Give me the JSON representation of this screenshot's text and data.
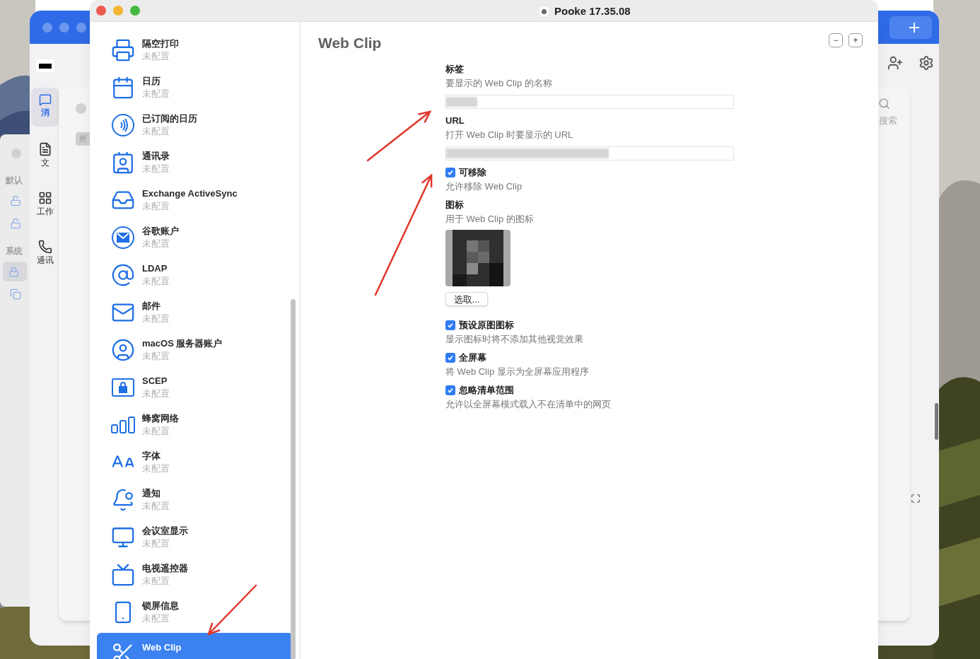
{
  "window": {
    "title": "Pooke 17.35.08"
  },
  "sidebar": {
    "items": [
      {
        "kind": "printer",
        "title": "隔空打印",
        "subtitle": "未配置",
        "selected": false
      },
      {
        "kind": "calendar",
        "title": "日历",
        "subtitle": "未配置",
        "selected": false
      },
      {
        "kind": "subscribed",
        "title": "已订阅的日历",
        "subtitle": "未配置",
        "selected": false
      },
      {
        "kind": "contacts",
        "title": "通讯录",
        "subtitle": "未配置",
        "selected": false
      },
      {
        "kind": "inbox",
        "title": "Exchange ActiveSync",
        "subtitle": "未配置",
        "selected": false
      },
      {
        "kind": "google",
        "title": "谷歌账户",
        "subtitle": "未配置",
        "selected": false
      },
      {
        "kind": "at",
        "title": "LDAP",
        "subtitle": "未配置",
        "selected": false
      },
      {
        "kind": "mail",
        "title": "邮件",
        "subtitle": "未配置",
        "selected": false
      },
      {
        "kind": "user",
        "title": "macOS 服务器账户",
        "subtitle": "未配置",
        "selected": false
      },
      {
        "kind": "lock",
        "title": "SCEP",
        "subtitle": "未配置",
        "selected": false
      },
      {
        "kind": "cellular",
        "title": "蜂窝网络",
        "subtitle": "未配置",
        "selected": false
      },
      {
        "kind": "font",
        "title": "字体",
        "subtitle": "未配置",
        "selected": false
      },
      {
        "kind": "bell",
        "title": "通知",
        "subtitle": "未配置",
        "selected": false
      },
      {
        "kind": "monitor",
        "title": "会议室显示",
        "subtitle": "未配置",
        "selected": false
      },
      {
        "kind": "tv",
        "title": "电视遥控器",
        "subtitle": "未配置",
        "selected": false
      },
      {
        "kind": "phone",
        "title": "锁屏信息",
        "subtitle": "未配置",
        "selected": false
      },
      {
        "kind": "scissors",
        "title": "Web Clip",
        "selected": true
      }
    ]
  },
  "detail": {
    "title": "Web Clip",
    "buttons": [
      "−",
      "+"
    ],
    "fields": [
      {
        "kind": "text",
        "label": "标签",
        "description": "要显示的 Web Clip 的名称"
      },
      {
        "kind": "text",
        "label": "URL",
        "description": "打开 Web Clip 时要显示的 URL"
      },
      {
        "kind": "checkbox",
        "label": "可移除",
        "description": "允许移除 Web Clip",
        "checked": true
      },
      {
        "label": "图标",
        "description": "用于 Web Clip 的图标",
        "button": "选取..."
      },
      {
        "kind": "checkbox",
        "label": "预设原图图标",
        "description": "显示图标时将不添加其他视觉效果",
        "checked": true
      },
      {
        "kind": "checkbox",
        "label": "全屏幕",
        "description": "将 Web Clip 显示为全屏幕应用程序",
        "checked": true
      },
      {
        "kind": "checkbox",
        "label": "忽略清单范围",
        "description": "允许以全屏幕模式载入不在清单中的网页",
        "checked": true
      }
    ]
  },
  "background": {
    "nav": [
      {
        "label": "消",
        "selected": true
      },
      {
        "label": "文",
        "selected": false
      },
      {
        "label": "工作",
        "selected": false
      },
      {
        "label": "通讯",
        "selected": false
      }
    ],
    "sections": [
      "默认",
      "系统"
    ],
    "filter": "所",
    "search": "搜索"
  }
}
